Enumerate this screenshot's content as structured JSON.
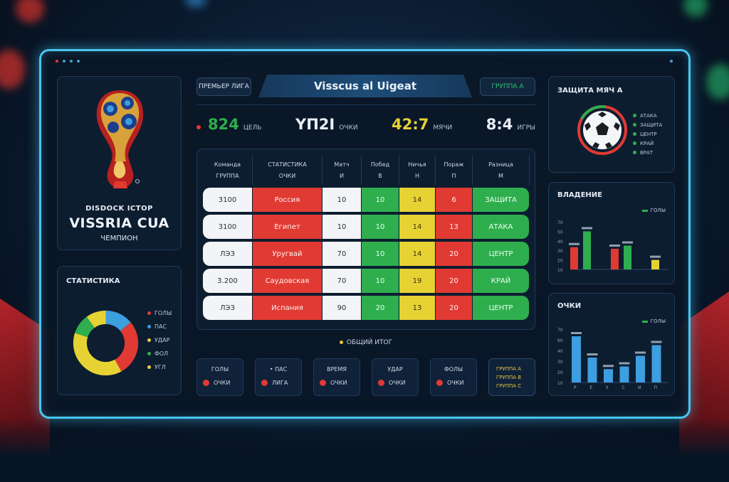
{
  "header": {
    "left_pill": "ПРЕМЬЕР ЛИГА",
    "title": "Visscus al Uigeat",
    "right_pill": "ГРУППА А"
  },
  "logo": {
    "small": "DISDOCK ICTOP",
    "title": "VISSRIA CUA",
    "sub": "ЧЕМПИОН"
  },
  "scores": [
    {
      "value": "824",
      "label": "ЦЕЛЬ",
      "color": "#2fae4e",
      "dot": true
    },
    {
      "value": "ΥΠ2Ι",
      "label": "ОЧКИ",
      "color": "#e8eef6",
      "dot": false
    },
    {
      "value": "42:7",
      "label": "МЯЧИ",
      "color": "#e6d233",
      "dot": false
    },
    {
      "value": "8:4",
      "label": "ИГРЫ",
      "color": "#e8eef6",
      "dot": false
    }
  ],
  "table": {
    "headers": [
      [
        "Команда",
        "ГРУППА"
      ],
      [
        "СТАТИСТИКА",
        "ОЧКИ"
      ],
      [
        "Матч",
        "И"
      ],
      [
        "Побед",
        "В"
      ],
      [
        "Ничья",
        "Н"
      ],
      [
        "Пораж",
        "П"
      ],
      [
        "Разница",
        "М"
      ]
    ],
    "rows": [
      [
        "3100",
        "Россия",
        "10",
        "10",
        "14",
        "6",
        "ЗАЩИТА"
      ],
      [
        "3100",
        "Египет",
        "10",
        "10",
        "14",
        "13",
        "АТАКА"
      ],
      [
        "ЛЭЗ",
        "Уругвай",
        "70",
        "10",
        "14",
        "20",
        "ЦЕНТР"
      ],
      [
        "3.200",
        "Саудовская",
        "70",
        "10",
        "19",
        "20",
        "КРАЙ"
      ],
      [
        "ЛЭЗ",
        "Испания",
        "90",
        "20",
        "13",
        "20",
        "ЦЕНТР"
      ]
    ],
    "footer": "ОБЩИЙ ИТОГ"
  },
  "cards": [
    {
      "top": "ГОЛЫ",
      "bot": "ОЧКИ"
    },
    {
      "top": "• ПАС",
      "bot": "ЛИГА"
    },
    {
      "top": "ВРЕМЯ",
      "bot": "ОЧКИ"
    },
    {
      "top": "УДАР",
      "bot": "ОЧКИ"
    },
    {
      "top": "ФОЛЫ",
      "bot": "ОЧКИ"
    }
  ],
  "card_last": {
    "line1": "ГРУППА A",
    "line2": "ГРУППА B",
    "line3": "ГРУППА C"
  },
  "donut": {
    "title": "СТАТИСТИКА",
    "segments": [
      {
        "label": "ГОЛЫ",
        "value": 28,
        "color": "#e13a33"
      },
      {
        "label": "ПАС",
        "value": 14,
        "color": "#3d9ee0"
      },
      {
        "label": "УДАР",
        "value": 38,
        "color": "#e6d233"
      },
      {
        "label": "ФОЛ",
        "value": 10,
        "color": "#2fae4e"
      },
      {
        "label": "УГЛ",
        "value": 10,
        "color": "#e6d233"
      }
    ]
  },
  "ball_panel": {
    "title": "ЗАЩИТА МЯЧ А",
    "legend": [
      {
        "label": "АТАКА",
        "color": "#2fae4e"
      },
      {
        "label": "ЗАЩИТА",
        "color": "#2fae4e"
      },
      {
        "label": "ЦЕНТР",
        "color": "#2fae4e"
      },
      {
        "label": "КРАЙ",
        "color": "#2fae4e"
      },
      {
        "label": "ВРАТ",
        "color": "#2fae4e"
      }
    ]
  },
  "bars1": {
    "title": "ВЛАДЕНИЕ",
    "legend": "ГОЛЫ",
    "ylabels": [
      "70",
      "50",
      "40",
      "30",
      "20",
      "10"
    ],
    "groups": [
      {
        "values": [
          28,
          48
        ],
        "colors": [
          "#e13a33",
          "#2fae4e"
        ]
      },
      {
        "values": [
          26,
          30
        ],
        "colors": [
          "#e13a33",
          "#2fae4e"
        ]
      },
      {
        "values": [
          12
        ],
        "colors": [
          "#e6d233"
        ]
      }
    ]
  },
  "bars2": {
    "title": "ОЧКИ",
    "legend": "ГОЛЫ",
    "ylabels": [
      "70",
      "60",
      "40",
      "30",
      "20",
      "10"
    ],
    "values": [
      52,
      28,
      15,
      18,
      30,
      42
    ],
    "xlabels": [
      "Р",
      "Е",
      "У",
      "С",
      "И",
      "П"
    ]
  }
}
